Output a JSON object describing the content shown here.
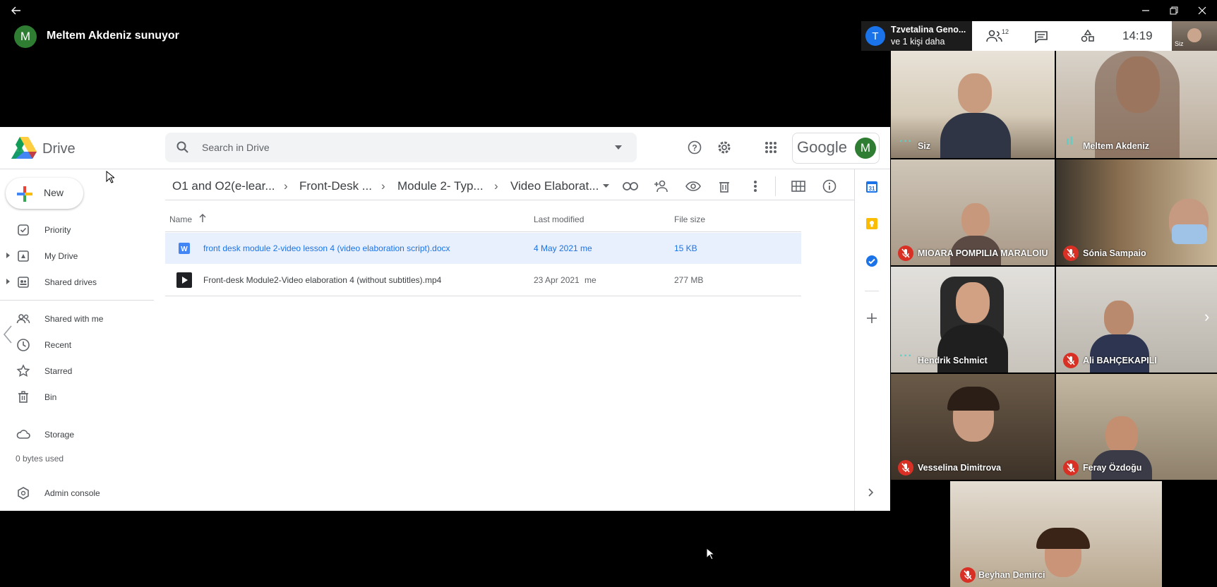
{
  "presenter": {
    "avatar_letter": "M",
    "text": "Meltem Akdeniz sunuyor"
  },
  "meet": {
    "others_title": "Tzvetalina Geno...",
    "others_sub": "ve 1 kişi daha",
    "others_avatar": "T",
    "people_count": "12",
    "time": "14:19",
    "self_thumb_label": "Siz"
  },
  "drive": {
    "logo_text": "Drive",
    "search_placeholder": "Search in Drive",
    "google_text": "Google",
    "account_letter": "M",
    "new_label": "New",
    "nav": [
      {
        "label": "Priority",
        "icon": "priority-icon"
      },
      {
        "label": "My Drive",
        "icon": "my-drive-icon"
      },
      {
        "label": "Shared drives",
        "icon": "shared-drives-icon"
      },
      {
        "label": "Shared with me",
        "icon": "shared-with-me-icon"
      },
      {
        "label": "Recent",
        "icon": "recent-icon"
      },
      {
        "label": "Starred",
        "icon": "starred-icon"
      },
      {
        "label": "Bin",
        "icon": "bin-icon"
      },
      {
        "label": "Storage",
        "icon": "storage-icon"
      }
    ],
    "storage_used": "0 bytes used",
    "admin_console": "Admin console",
    "breadcrumb": [
      "O1 and O2(e-lear...",
      "Front-Desk ...",
      "Module 2- Typ...",
      "Video Elaborat..."
    ],
    "columns": {
      "name": "Name",
      "modified": "Last modified",
      "size": "File size"
    },
    "files": [
      {
        "name": "front desk module 2-video lesson 4 (video elaboration script).docx",
        "modified": "4 May 2021",
        "owner": "me",
        "size": "15 KB",
        "type": "docx",
        "selected": true
      },
      {
        "name": "Front-desk Module2-Video elaboration 4 (without subtitles).mp4",
        "modified": "23 Apr 2021",
        "owner": "me",
        "size": "277 MB",
        "type": "mp4",
        "selected": false
      }
    ]
  },
  "participants": [
    {
      "name": "Siz",
      "status": "dots"
    },
    {
      "name": "Meltem Akdeniz",
      "status": "speaking"
    },
    {
      "name": "MIOARA POMPILIA MARALOIU",
      "status": "muted"
    },
    {
      "name": "Sónia Sampaio",
      "status": "muted"
    },
    {
      "name": "Hendrik Schmict",
      "status": "dots"
    },
    {
      "name": "Ali BAHÇEKAPILI",
      "status": "muted"
    },
    {
      "name": "Vesselina Dimitrova",
      "status": "muted"
    },
    {
      "name": "Feray Özdoğu",
      "status": "muted"
    },
    {
      "name": "Beyhan Demirci",
      "status": "muted"
    }
  ],
  "colors": {
    "accent": "#1a73e8",
    "muted_red": "#d93025",
    "selected_row": "#e8f0fe",
    "avatar_green": "#2e7d32",
    "avatar_blue": "#1a73e8"
  }
}
